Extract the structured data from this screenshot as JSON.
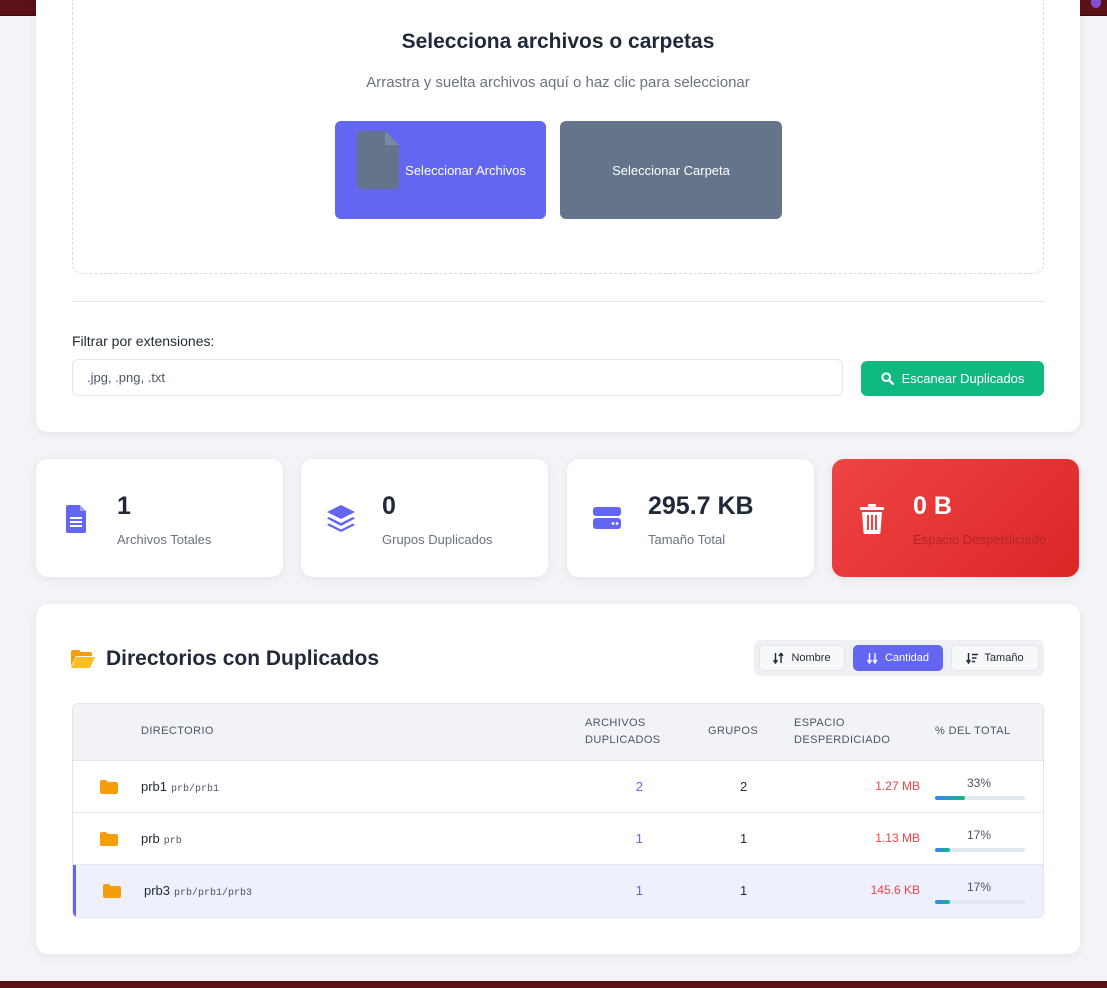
{
  "upload": {
    "title": "Selecciona archivos o carpetas",
    "subtitle": "Arrastra y suelta archivos aquí o haz clic para seleccionar",
    "select_files_label": "Seleccionar Archivos",
    "select_folder_label": "Seleccionar Carpeta"
  },
  "filter": {
    "label": "Filtrar por extensiones:",
    "placeholder": ".jpg, .png, .txt",
    "scan_label": "Escanear Duplicados"
  },
  "stats": [
    {
      "value": "1",
      "label": "Archivos Totales",
      "icon": "file-icon"
    },
    {
      "value": "0",
      "label": "Grupos Duplicados",
      "icon": "layers-icon"
    },
    {
      "value": "295.7 KB",
      "label": "Tamaño Total",
      "icon": "hard-drive-icon"
    },
    {
      "value": "0 B",
      "label": "Espacio Desperdiciado",
      "icon": "trash-icon"
    }
  ],
  "directories": {
    "title": "Directorios con Duplicados",
    "sort": {
      "name_label": "Nombre",
      "count_label": "Cantidad",
      "size_label": "Tamaño",
      "active": "Cantidad"
    },
    "columns": {
      "directory": "DIRECTORIO",
      "dup_files_1": "ARCHIVOS",
      "dup_files_2": "DUPLICADOS",
      "groups": "GRUPOS",
      "waste_1": "ESPACIO",
      "waste_2": "DESPERDICIADO",
      "percent": "% DEL TOTAL"
    },
    "rows": [
      {
        "name": "prb1",
        "path": "prb/prb1",
        "duplicates": "2",
        "groups": "2",
        "waste": "1.27 MB",
        "percent": "33%",
        "fraction": 0.33
      },
      {
        "name": "prb",
        "path": "prb",
        "duplicates": "1",
        "groups": "1",
        "waste": "1.13 MB",
        "percent": "17%",
        "fraction": 0.17
      },
      {
        "name": "prb3",
        "path": "prb/prb1/prb3",
        "duplicates": "1",
        "groups": "1",
        "waste": "145.6 KB",
        "percent": "17%",
        "fraction": 0.17
      }
    ]
  },
  "colors": {
    "accent": "#6366f1",
    "success": "#10b981",
    "danger": "#ef4444",
    "folder": "#f59e0b"
  }
}
